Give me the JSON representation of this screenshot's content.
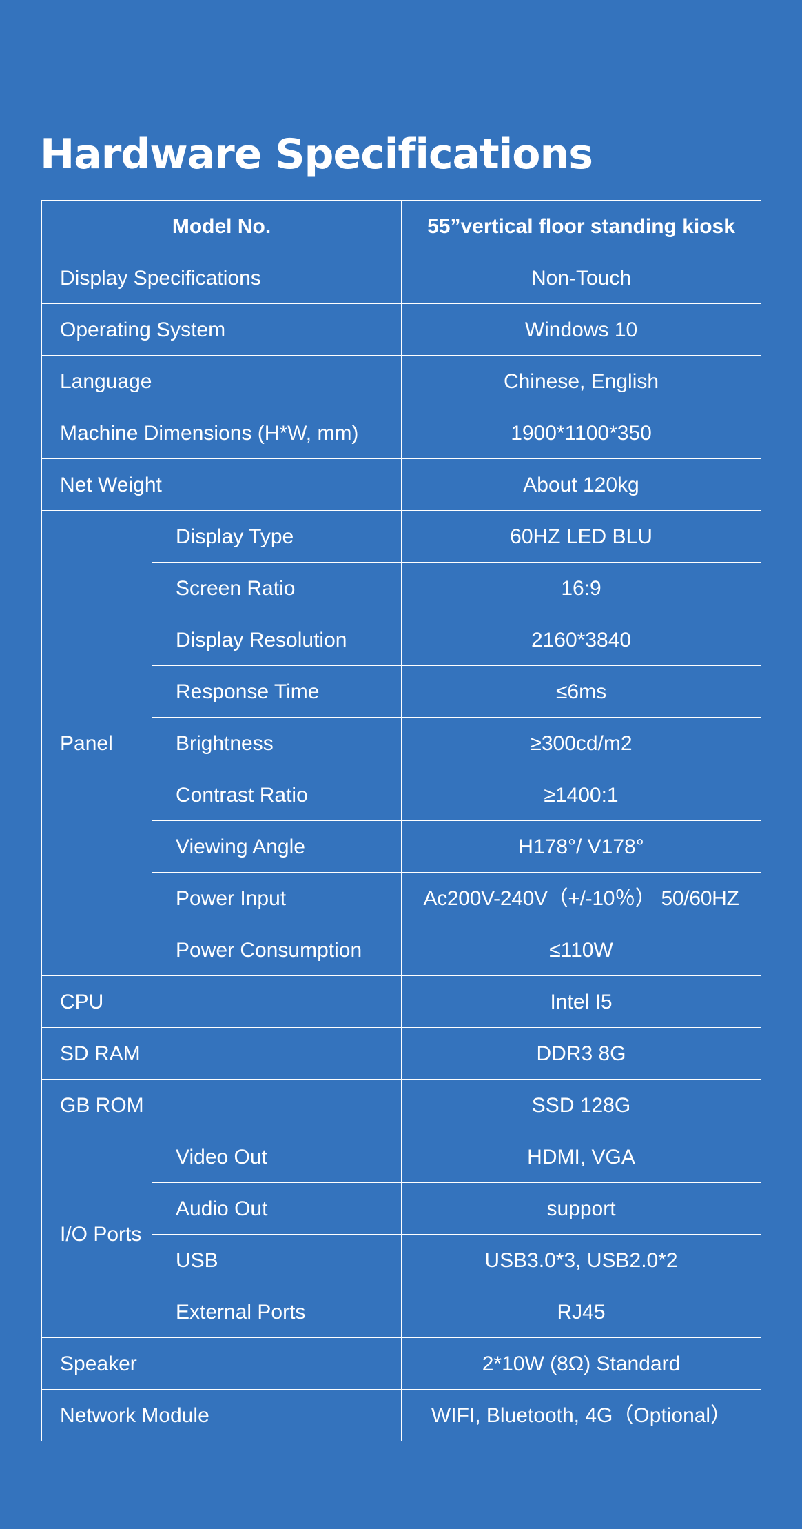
{
  "title": "Hardware Specifications",
  "header": {
    "label": "Model No.",
    "value": "55”vertical floor standing kiosk"
  },
  "rows_top": [
    {
      "label": "Display Specifications",
      "value": "Non-Touch"
    },
    {
      "label": "Operating System",
      "value": "Windows 10"
    },
    {
      "label": "Language",
      "value": "Chinese, English"
    },
    {
      "label": "Machine Dimensions (H*W, mm)",
      "value": "1900*1100*350"
    },
    {
      "label": "Net Weight",
      "value": "About 120kg"
    }
  ],
  "panel": {
    "group_label": "Panel",
    "rows": [
      {
        "label": "Display Type",
        "value": "60HZ LED BLU"
      },
      {
        "label": "Screen Ratio",
        "value": "16:9"
      },
      {
        "label": "Display Resolution",
        "value": "2160*3840"
      },
      {
        "label": "Response Time",
        "value": "≤6ms"
      },
      {
        "label": "Brightness",
        "value": "≥300cd/m2"
      },
      {
        "label": "Contrast Ratio",
        "value": "≥1400:1"
      },
      {
        "label": "Viewing Angle",
        "value": "H178°/ V178°"
      },
      {
        "label": "Power Input",
        "value": "Ac200V-240V（+/-10％） 50/60HZ"
      },
      {
        "label": "Power Consumption",
        "value": "≤110W"
      }
    ]
  },
  "rows_mid": [
    {
      "label": "CPU",
      "value": "Intel I5"
    },
    {
      "label": "SD RAM",
      "value": "DDR3 8G"
    },
    {
      "label": "GB ROM",
      "value": "SSD 128G"
    }
  ],
  "io_ports": {
    "group_label": "I/O Ports",
    "rows": [
      {
        "label": "Video Out",
        "value": "HDMI, VGA"
      },
      {
        "label": "Audio Out",
        "value": "support"
      },
      {
        "label": "USB",
        "value": "USB3.0*3, USB2.0*2"
      },
      {
        "label": "External Ports",
        "value": "RJ45"
      }
    ]
  },
  "rows_bottom": [
    {
      "label": "Speaker",
      "value": "2*10W (8Ω) Standard"
    },
    {
      "label": "Network Module",
      "value": "WIFI, Bluetooth, 4G（Optional）"
    }
  ]
}
